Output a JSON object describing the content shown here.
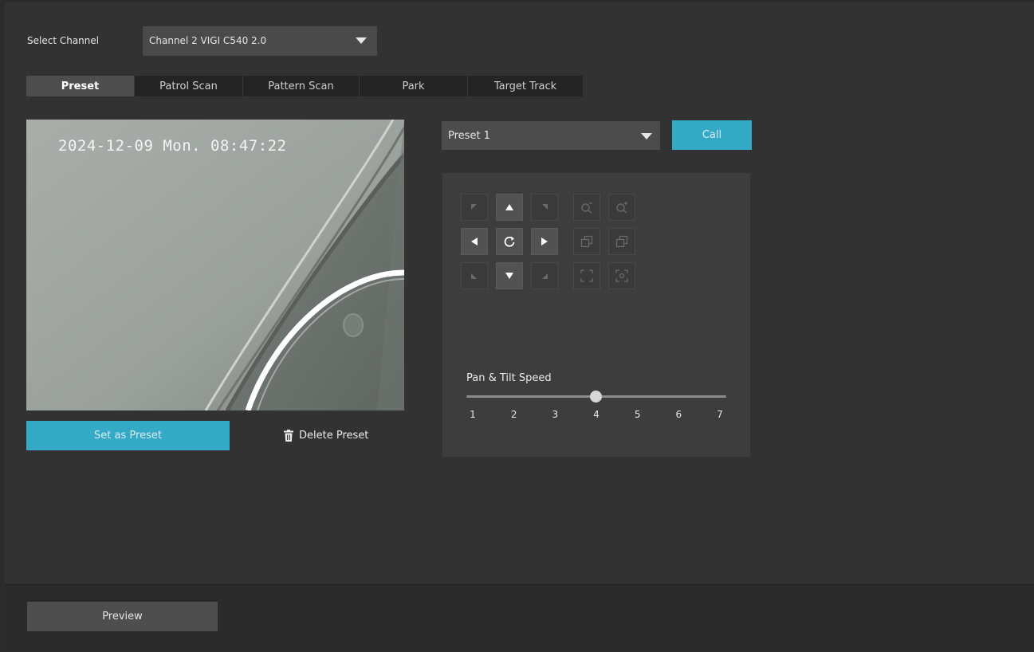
{
  "channel": {
    "label": "Select Channel",
    "selected": "Channel 2 VIGI C540 2.0"
  },
  "tabs": [
    {
      "label": "Preset",
      "active": true
    },
    {
      "label": "Patrol Scan",
      "active": false
    },
    {
      "label": "Pattern Scan",
      "active": false
    },
    {
      "label": "Park",
      "active": false
    },
    {
      "label": "Target Track",
      "active": false
    }
  ],
  "video": {
    "timestamp": "2024-12-09 Mon. 08:47:22"
  },
  "actions": {
    "set_preset": "Set as Preset",
    "delete_preset": "Delete Preset",
    "call": "Call"
  },
  "preset": {
    "selected": "Preset 1"
  },
  "ptz": {
    "speed_label": "Pan & Tilt Speed",
    "speed_ticks": [
      "1",
      "2",
      "3",
      "4",
      "5",
      "6",
      "7"
    ],
    "speed_value": 4,
    "speed_min": 1,
    "speed_max": 7
  },
  "footer": {
    "preview": "Preview"
  },
  "colors": {
    "accent": "#35aac7",
    "background": "#323232",
    "panel": "#3d3d3d"
  }
}
